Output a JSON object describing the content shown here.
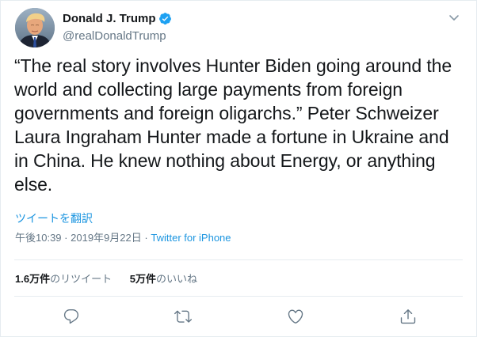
{
  "author": {
    "display_name": "Donald J. Trump",
    "handle": "@realDonaldTrump",
    "avatar_icon": "profile-photo",
    "verified_icon": "verified-badge-icon"
  },
  "tweet": {
    "text": "“The real story involves Hunter Biden going around the world and collecting large payments from foreign governments and foreign oligarchs.” Peter Schweizer Laura Ingraham Hunter made a fortune in Ukraine and in China. He knew nothing about Energy, or anything else.",
    "translate_label": "ツイートを翻訳",
    "time": "午後10:39",
    "date": "2019年9月22日",
    "separator": "·",
    "source": "Twitter for iPhone"
  },
  "stats": {
    "retweets_count": "1.6万件",
    "retweets_label": "のリツイート",
    "likes_count": "5万件",
    "likes_label": "のいいね"
  },
  "actions": {
    "icons": [
      "reply-icon",
      "retweet-icon",
      "like-icon",
      "share-icon"
    ]
  },
  "colors": {
    "link_blue": "#1b95e0",
    "verified_blue": "#1da1f2",
    "secondary_text": "#657786",
    "primary_text": "#14171a",
    "divider": "#e6ecf0"
  }
}
